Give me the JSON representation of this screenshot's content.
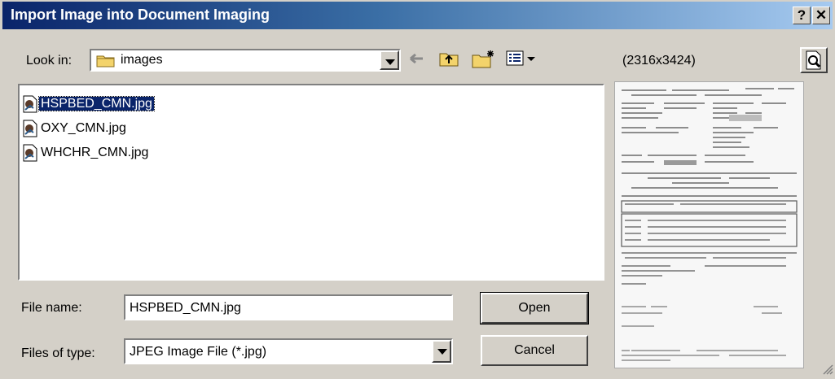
{
  "dialog": {
    "title": "Import Image into Document Imaging",
    "help_glyph": "?",
    "close_glyph": "✕"
  },
  "lookin": {
    "label": "Look in:",
    "folder": "images"
  },
  "toolbar": {
    "back_icon": "arrow-left",
    "up_icon": "folder-up",
    "new_folder_icon": "new-folder",
    "view_menu_icon": "view-menu"
  },
  "preview": {
    "dimensions": "(2316x3424)",
    "toggle_icon": "preview"
  },
  "files": [
    {
      "name": "HSPBED_CMN.jpg",
      "selected": true
    },
    {
      "name": "OXY_CMN.jpg",
      "selected": false
    },
    {
      "name": "WHCHR_CMN.jpg",
      "selected": false
    }
  ],
  "filename": {
    "label": "File name:",
    "value": "HSPBED_CMN.jpg"
  },
  "filetype": {
    "label": "Files of type:",
    "value": "JPEG Image File (*.jpg)"
  },
  "buttons": {
    "open": "Open",
    "cancel": "Cancel"
  },
  "colors": {
    "title_start": "#0a246a",
    "title_end": "#a6caf0",
    "selection": "#0a246a",
    "face": "#d4d0c8"
  }
}
